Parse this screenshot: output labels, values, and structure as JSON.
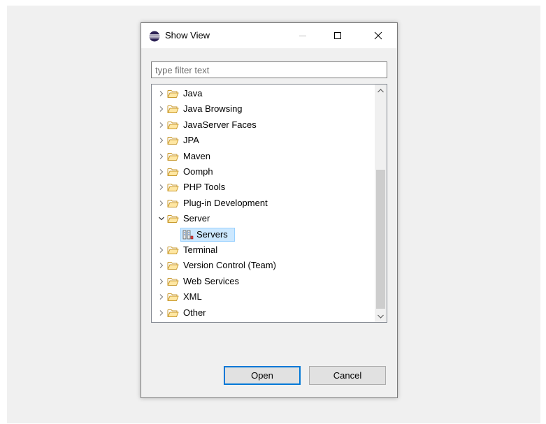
{
  "window": {
    "title": "Show View",
    "controls": {
      "minimize": "—",
      "maximize": "☐",
      "close": "✕"
    }
  },
  "filter": {
    "placeholder": "type filter text",
    "value": ""
  },
  "tree": {
    "items": [
      {
        "label": "Java",
        "expanded": false
      },
      {
        "label": "Java Browsing",
        "expanded": false
      },
      {
        "label": "JavaServer Faces",
        "expanded": false
      },
      {
        "label": "JPA",
        "expanded": false
      },
      {
        "label": "Maven",
        "expanded": false
      },
      {
        "label": "Oomph",
        "expanded": false
      },
      {
        "label": "PHP Tools",
        "expanded": false
      },
      {
        "label": "Plug-in Development",
        "expanded": false
      },
      {
        "label": "Server",
        "expanded": true,
        "children": [
          {
            "label": "Servers",
            "selected": true,
            "icon": "servers-icon"
          }
        ]
      },
      {
        "label": "Terminal",
        "expanded": false
      },
      {
        "label": "Version Control (Team)",
        "expanded": false
      },
      {
        "label": "Web Services",
        "expanded": false
      },
      {
        "label": "XML",
        "expanded": false
      },
      {
        "label": "Other",
        "expanded": false
      }
    ]
  },
  "buttons": {
    "open": "Open",
    "cancel": "Cancel"
  },
  "colors": {
    "selection": "#cce8ff",
    "selection_border": "#99d1ff",
    "folder": "#dcb04b",
    "accent": "#0078d7"
  }
}
